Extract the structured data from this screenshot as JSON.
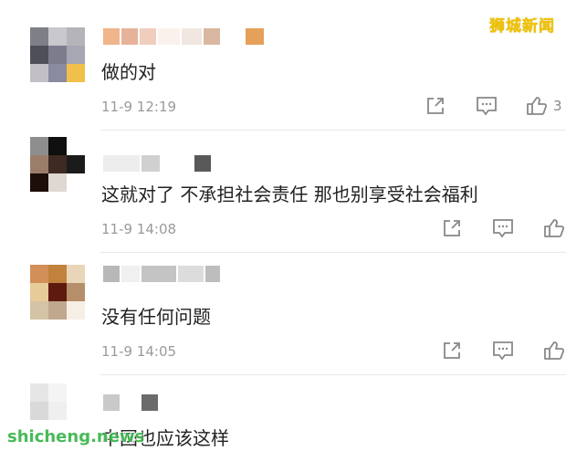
{
  "watermark": {
    "top": "狮城新闻",
    "bottom": "shicheng.news"
  },
  "comments": [
    {
      "text": "做的对",
      "time": "11-9 12:19",
      "likes": "3"
    },
    {
      "text": "这就对了 不承担社会责任 那也别享受社会福利",
      "time": "11-9 14:08",
      "likes": ""
    },
    {
      "text": "没有任何问题",
      "time": "11-9 14:05",
      "likes": ""
    },
    {
      "text": "中国也应该这样",
      "time": "",
      "likes": ""
    }
  ],
  "icons": [
    "share-icon",
    "comment-icon",
    "like-icon"
  ],
  "colors": {
    "time": "#9a9a9a",
    "text": "#222222",
    "watermark_top": "#f2c300",
    "watermark_bottom": "#39b54a"
  }
}
